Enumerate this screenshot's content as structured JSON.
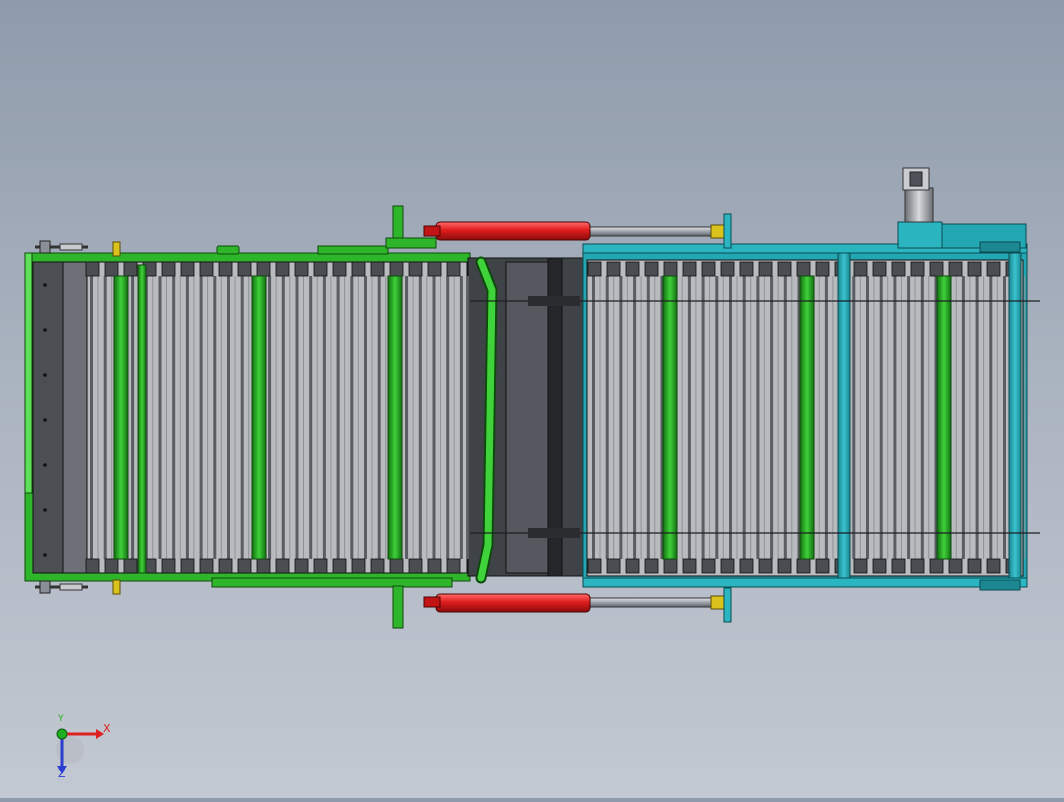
{
  "scene": {
    "background_top": "#8f9bab",
    "background_bottom": "#c3c9d2",
    "colors": {
      "frame_green": "#2fb52a",
      "frame_green_dark": "#1b7d18",
      "frame_teal": "#23a7b3",
      "cylinder_red": "#e01c1c",
      "rod_gray": "#8b8f97",
      "belt_light": "#c4c6ca",
      "belt_dark": "#5a5d63",
      "clamp_yellow": "#d9c21c"
    }
  },
  "triad": {
    "x_label": "X",
    "y_label": "Y",
    "z_label": "Z",
    "x_color": "#e02020",
    "y_color": "#1fae1f",
    "z_color": "#2a3fd0"
  }
}
